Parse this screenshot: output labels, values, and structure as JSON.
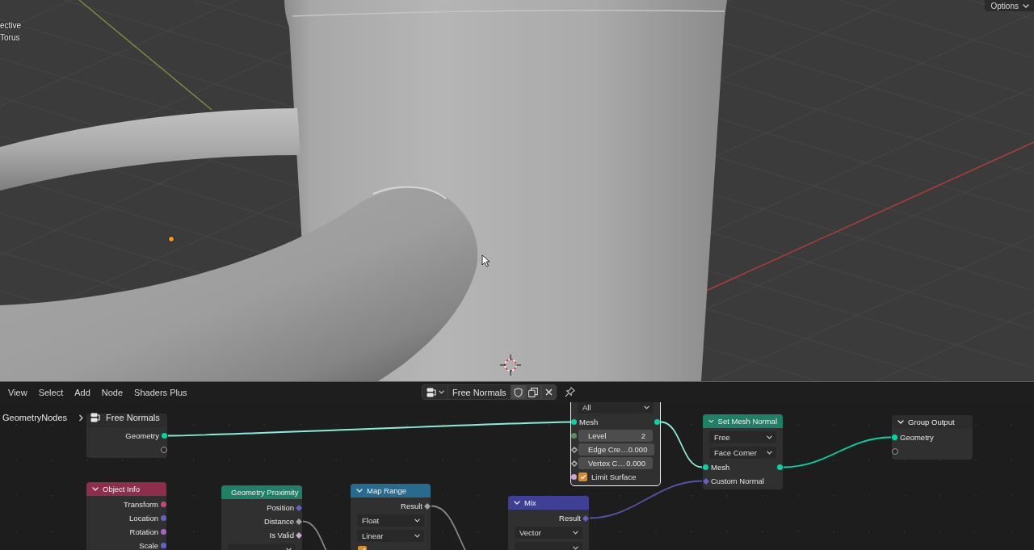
{
  "viewport": {
    "overlay_text": [
      "ective",
      "Torus"
    ],
    "options_button": "Options"
  },
  "node_editor": {
    "menu": [
      "View",
      "Select",
      "Add",
      "Node",
      "Shaders Plus"
    ],
    "node_group": {
      "name": "Free Normals"
    },
    "breadcrumb": [
      "GeometryNodes",
      "Free Normals"
    ],
    "nodes": [
      {
        "color": "#2c2c2c",
        "selected": false,
        "rows": [
          {
            "kind": "output",
            "label": "Geometry",
            "color": "#00d6a3",
            "field": false
          },
          {
            "kind": "empty-output"
          }
        ]
      },
      {
        "selected": true,
        "rows": [
          {
            "kind": "dropdown",
            "value": "All"
          },
          {
            "kind": "passthrough",
            "label": "Mesh",
            "color": "#00d6a3",
            "field": false
          },
          {
            "kind": "field",
            "label": "Level",
            "value": "2",
            "color": "#598c5c",
            "field": false,
            "hollow": false
          },
          {
            "kind": "field",
            "label": "Edge Cre…",
            "value": "0.000",
            "color": "#a1a1a1",
            "field": true,
            "hollow": true
          },
          {
            "kind": "field",
            "label": "Vertex C…",
            "value": "0.000",
            "color": "#a1a1a1",
            "field": true,
            "hollow": true
          },
          {
            "kind": "checkbox",
            "label": "Limit Surface",
            "checked": true,
            "color": "#cca6d6",
            "field": false
          }
        ]
      },
      {
        "title": "Set Mesh Normal",
        "color": "#1f7f67",
        "selected": false,
        "rows": [
          {
            "kind": "dropdown",
            "value": "Free"
          },
          {
            "kind": "dropdown",
            "value": "Face Corner"
          },
          {
            "kind": "passthrough",
            "label": "Mesh",
            "color": "#00d6a3",
            "field": false
          },
          {
            "kind": "input",
            "label": "Custom Normal",
            "color": "#6363c7",
            "field": true
          }
        ]
      },
      {
        "title": "Group Output",
        "color": "#2c2c2c",
        "selected": false,
        "rows": [
          {
            "kind": "input",
            "label": "Geometry",
            "color": "#00d6a3",
            "field": false
          },
          {
            "kind": "empty-input"
          }
        ]
      },
      {
        "title": "Object Info",
        "color": "#8e2e4c",
        "selected": false,
        "rows": [
          {
            "kind": "output",
            "label": "Transform",
            "color": "#c4467e",
            "field": false
          },
          {
            "kind": "output",
            "label": "Location",
            "color": "#6363c7",
            "field": false
          },
          {
            "kind": "output",
            "label": "Rotation",
            "color": "#a663c7",
            "field": false
          },
          {
            "kind": "output",
            "label": "Scale",
            "color": "#6363c7",
            "field": false
          }
        ]
      },
      {
        "title": "Geometry Proximity",
        "color": "#1f7f67",
        "selected": false,
        "rows": [
          {
            "kind": "output",
            "label": "Position",
            "color": "#6363c7",
            "field": true
          },
          {
            "kind": "output",
            "label": "Distance",
            "color": "#a1a1a1",
            "field": true
          },
          {
            "kind": "output",
            "label": "Is Valid",
            "color": "#cca6d6",
            "field": true
          },
          {
            "kind": "dropdown"
          }
        ]
      },
      {
        "title": "Map Range",
        "color": "#276b8f",
        "selected": false,
        "rows": [
          {
            "kind": "output",
            "label": "Result",
            "color": "#a1a1a1",
            "field": true
          },
          {
            "kind": "dropdown",
            "value": "Float"
          },
          {
            "kind": "dropdown",
            "value": "Linear"
          },
          {
            "kind": "checkbox",
            "checked": true
          }
        ]
      },
      {
        "title": "Mix",
        "color": "#3f3f96",
        "selected": false,
        "rows": [
          {
            "kind": "output",
            "label": "Result",
            "color": "#6363c7",
            "field": true
          },
          {
            "kind": "dropdown",
            "value": "Vector"
          },
          {
            "kind": "dropdown"
          }
        ]
      }
    ]
  }
}
